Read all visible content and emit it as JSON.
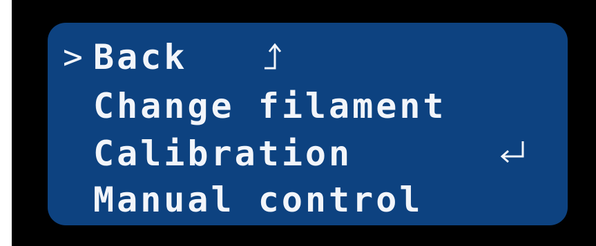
{
  "menu": {
    "cursor_glyph": ">",
    "items": [
      {
        "label": "Back"
      },
      {
        "label": "Change filament"
      },
      {
        "label": "Calibration"
      },
      {
        "label": "Manual control"
      }
    ],
    "icons": {
      "back": "up-arrow-icon",
      "calibration": "enter-arrow-icon"
    }
  },
  "colors": {
    "screen_bg": "#0d4280",
    "text": "#f2f5fa",
    "frame": "#000000"
  }
}
